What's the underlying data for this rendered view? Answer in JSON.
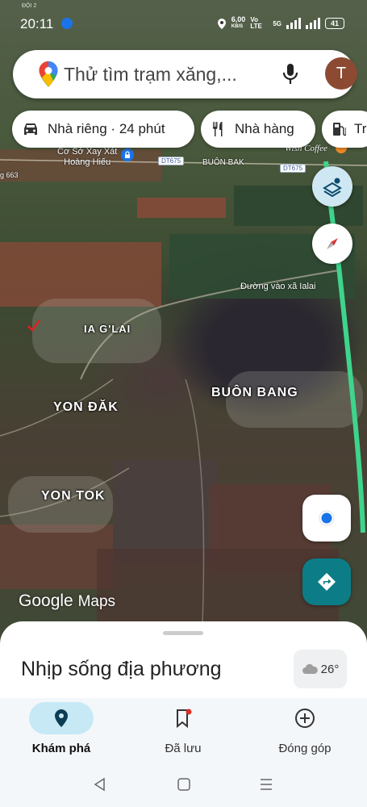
{
  "status_bar": {
    "carrier_sub": "ĐỘI 2",
    "time": "20:11",
    "speed_value": "6,00",
    "speed_unit": "KB/S",
    "volte": "Vo LTE",
    "net_5g": "5G",
    "battery": "41"
  },
  "search": {
    "placeholder": "Thử tìm trạm xăng,...",
    "avatar_letter": "T"
  },
  "chips": [
    {
      "label": "Nhà riêng · 24 phút",
      "icon": "car-icon"
    },
    {
      "label": "Nhà hàng",
      "icon": "fork-knife-icon"
    },
    {
      "label": "Tr",
      "icon": "gas-station-icon"
    }
  ],
  "map": {
    "places": {
      "rice_mill": "Cơ Sở Xay Xát\nHoàng Hiếu",
      "wish_coffee": "Wish Coffee",
      "buon_bak": "BUÔN BAK",
      "road_663": "g 663",
      "road_dt675_a": "DT675",
      "road_dt675_b": "DT675",
      "road_ialai": "Đường vào xã Ialai",
      "ia_glai": "IA G'LAI",
      "buon_bang": "BUÔN BANG",
      "yon_dak": "YON ĐĂK",
      "yon_tok": "YON TOK"
    },
    "attribution_google": "Google",
    "attribution_maps": "Maps"
  },
  "sheet": {
    "title": "Nhịp sống địa phương",
    "temperature": "26°"
  },
  "nav": {
    "items": [
      {
        "label": "Khám phá",
        "active": true
      },
      {
        "label": "Đã lưu",
        "active": false
      },
      {
        "label": "Đóng góp",
        "active": false
      }
    ]
  },
  "colors": {
    "accent_teal": "#0c7d86",
    "nav_active": "#c6e9f5",
    "route_green": "#3fd48c"
  }
}
